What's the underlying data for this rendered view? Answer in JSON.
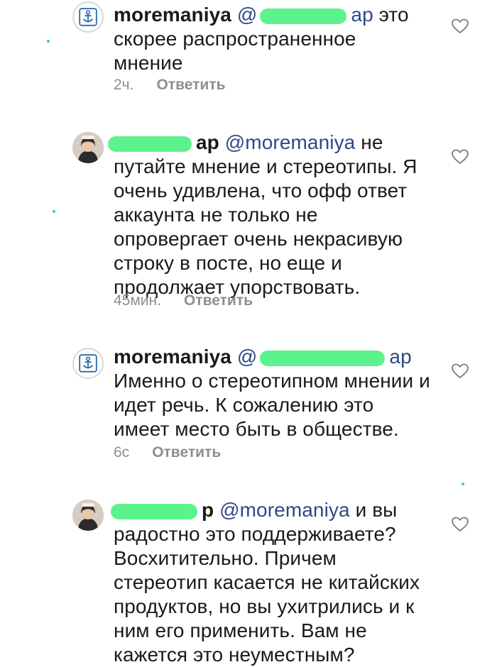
{
  "comments": [
    {
      "user": "moremaniya",
      "mention": "@",
      "mention_suffix": "ар",
      "body": " это\nскорее распространенное\nмнение",
      "time": "2ч.",
      "reply_label": "Ответить",
      "avatar_icon": "anchor-icon"
    },
    {
      "user": "",
      "user_suffix": "ар",
      "mention": "@moremaniya",
      "mention_suffix": "",
      "body": " не\nпутайте мнение и стереотипы. Я\nочень удивлена, что офф ответ\nаккаунта не только не\nопровергает очень некрасивую\nстроку в посте, но еще и\nпродолжает упорствовать.",
      "time": "45мин.",
      "reply_label": "Ответить",
      "avatar_icon": "user-photo"
    },
    {
      "user": "moremaniya",
      "mention": "@",
      "mention_suffix": "ар",
      "body": "\nИменно о стереотипном мнении и\nидет речь. К сожалению  это\nимеет место быть в обществе.",
      "time": "6с",
      "reply_label": "Ответить",
      "avatar_icon": "anchor-icon"
    },
    {
      "user": "",
      "user_suffix": "р",
      "mention": "@moremaniya",
      "mention_suffix": "",
      "body": " и вы\nрадостно это поддерживаете?\nВосхитительно. Причем\nстереотип касается не китайских\nпродуктов, но вы ухитрились и к\nним его применить. Вам не\nкажется это неуместным?",
      "time": "",
      "reply_label": "",
      "avatar_icon": "user-photo"
    }
  ],
  "colors": {
    "mention": "#2b4a86",
    "redaction": "#5df38c",
    "meta": "#8e8e8e"
  }
}
